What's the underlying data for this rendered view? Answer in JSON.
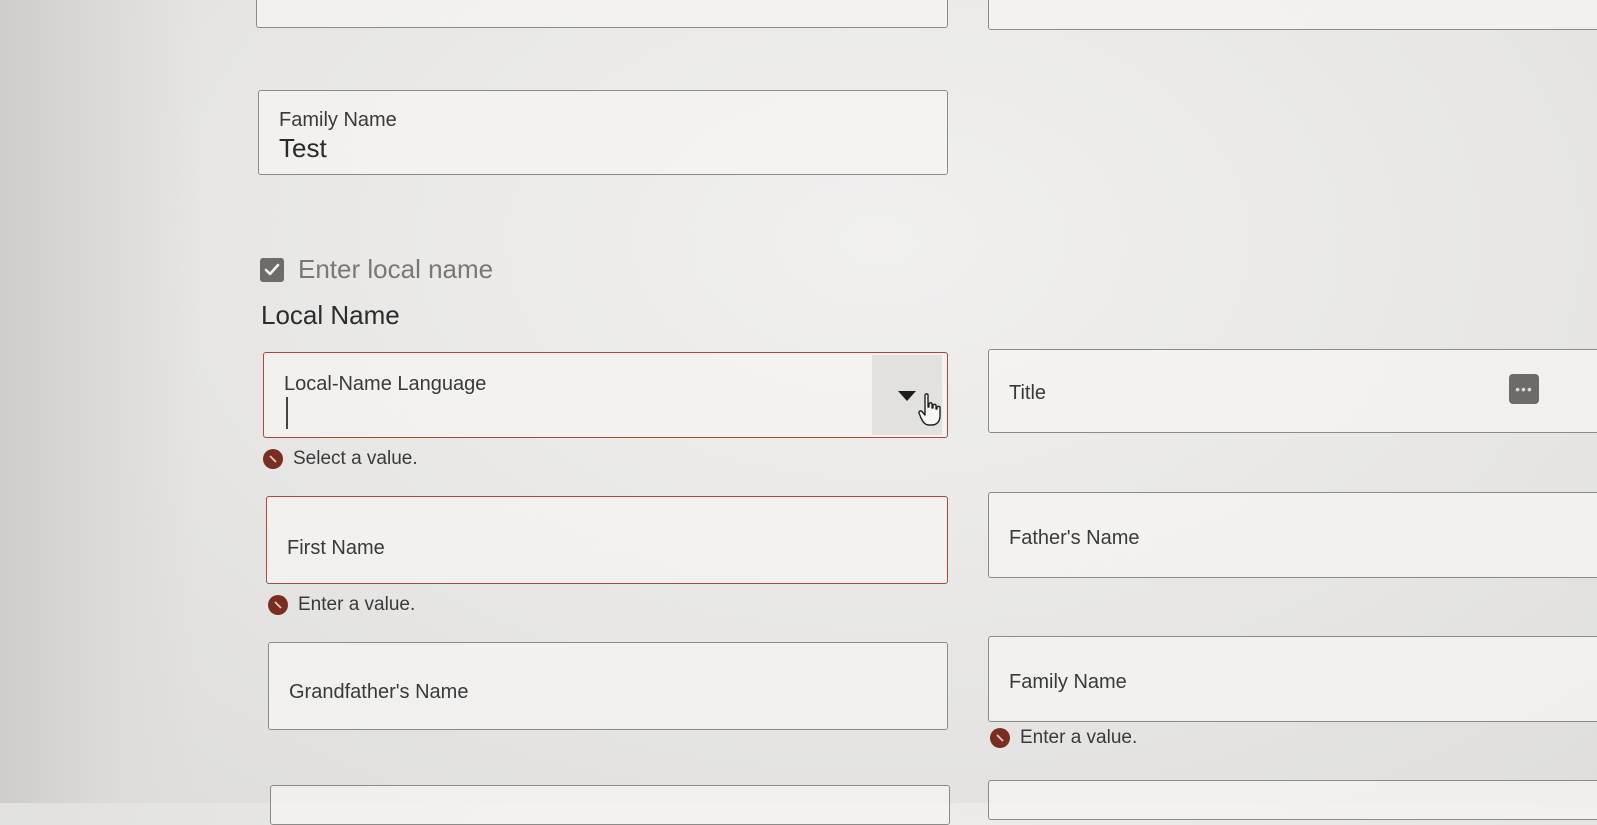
{
  "form": {
    "family_name_top": {
      "label": "Family Name",
      "value": "Test"
    },
    "local_name_checkbox": {
      "label": "Enter local name",
      "checked": true
    },
    "local_name_section": {
      "heading": "Local Name"
    },
    "local_name_language": {
      "label": "Local-Name Language",
      "value": "",
      "error": "Select a value."
    },
    "title": {
      "label": "Title",
      "more_icon": "ellipsis-icon"
    },
    "first_name": {
      "label": "First Name",
      "error": "Enter a value."
    },
    "fathers_name": {
      "label": "Father's Name"
    },
    "grandfathers_name": {
      "label": "Grandfather's Name"
    },
    "family_name_local": {
      "label": "Family Name",
      "error": "Enter a value."
    }
  },
  "icons": {
    "checkbox": "checkmark-icon",
    "error": "error-icon",
    "dropdown": "chevron-down-icon",
    "cursor": "hand-pointer-icon"
  },
  "colors": {
    "error": "#7a2e22",
    "error_border": "#a84a3c",
    "checkbox": "#6e6c69",
    "field_border": "#8d8b88"
  }
}
